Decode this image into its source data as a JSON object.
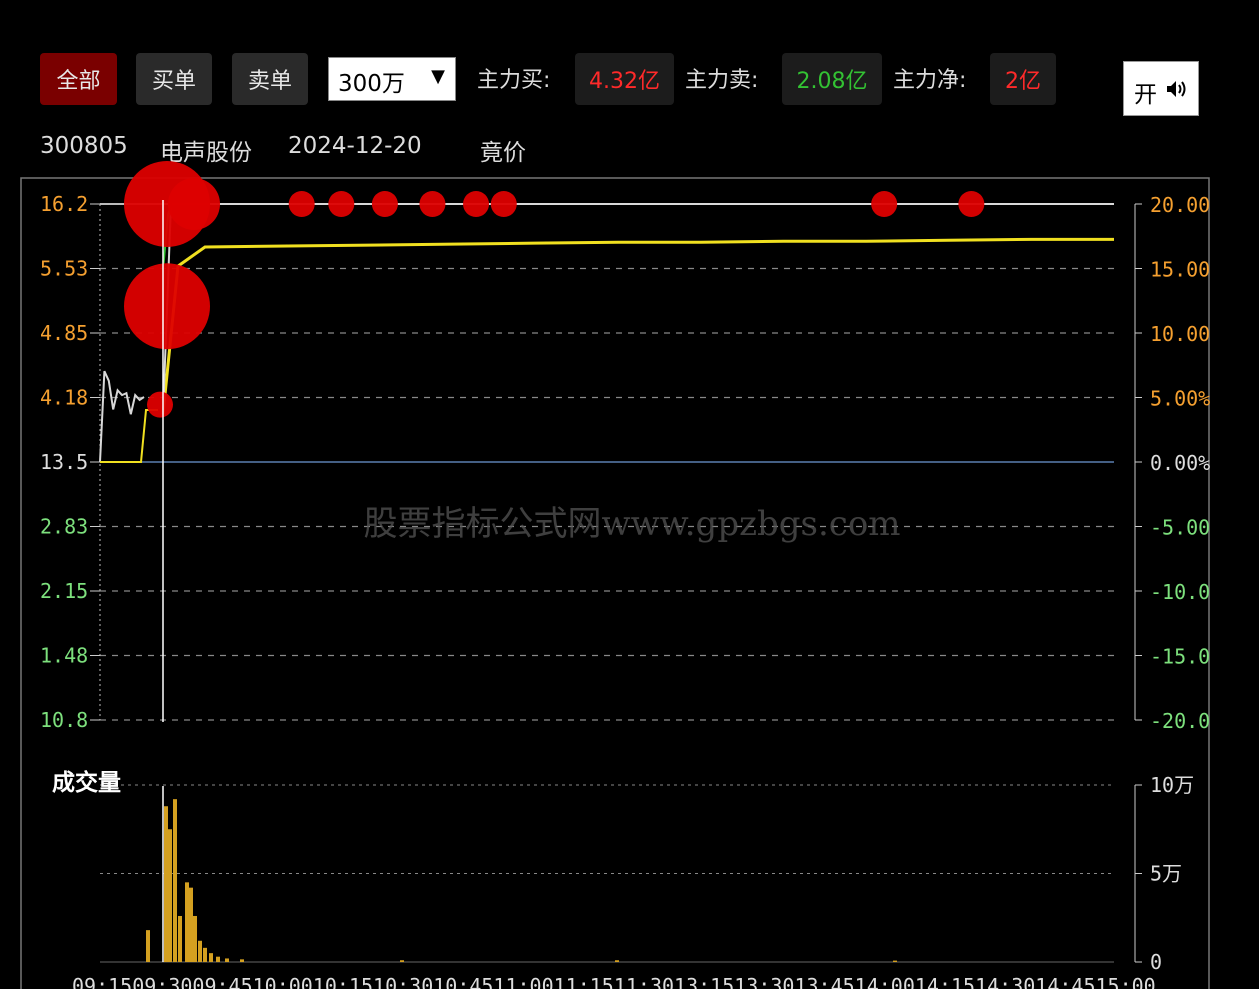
{
  "toolbar": {
    "filters": [
      "全部",
      "买单",
      "卖单"
    ],
    "active_filter": "全部",
    "threshold": "300万",
    "main_buy_label": "主力买:",
    "main_buy_value": "4.32亿",
    "main_sell_label": "主力卖:",
    "main_sell_value": "2.08亿",
    "main_net_label": "主力净:",
    "main_net_value": "2亿",
    "sound_toggle_label": "开"
  },
  "info": {
    "code": "300805",
    "name": "电声股份",
    "date": "2024-12-20",
    "mode": "竟价"
  },
  "watermark": "股票指标公式网www.gpzbgs.com",
  "volume_label": "成交量",
  "colors": {
    "bg": "#000000",
    "up": "#ff2a2a",
    "down": "#33c233",
    "price_line": "#d8d8d8",
    "avg_line": "#f0e020",
    "baseline": "#5b7fb0",
    "volume_bar": "#d4a020",
    "big_order": "#dd0000",
    "axis_up_label": "#f5a030",
    "axis_down_label": "#7de07d"
  },
  "chart_data": {
    "type": "line",
    "price_axis_left": [
      "16.2",
      "5.53",
      "4.85",
      "4.18",
      "13.5",
      "2.83",
      "2.15",
      "1.48",
      "10.8"
    ],
    "pct_axis_right": [
      "20.00",
      "15.00",
      "10.00",
      "5.00%",
      "0.00%",
      "-5.00",
      "-10.0",
      "-15.0",
      "-20.0"
    ],
    "volume_axis": [
      "10万",
      "5万",
      "0"
    ],
    "time_axis": [
      "09:15",
      "09:30",
      "09:45",
      "10:00",
      "10:15",
      "10:30",
      "10:45",
      "11:00",
      "11:15",
      "11:30",
      "13:15",
      "13:30",
      "13:45",
      "14:00",
      "14:15",
      "14:30",
      "14:45",
      "15:00"
    ],
    "time_axis_text": "09:1509:3009:4510:0010:1510:3010:4511:0011:1511:3013:1513:3013:4514:0014:1514:3014:4515:00",
    "auction_price": [
      13.5,
      14.45,
      14.35,
      14.05,
      14.25,
      14.2,
      14.22,
      14.0,
      14.2,
      14.15,
      14.18
    ],
    "price": [
      14.0,
      16.2,
      16.2,
      16.2,
      16.2,
      16.2,
      16.2,
      16.2,
      16.2,
      16.2,
      16.2,
      16.2,
      16.2,
      16.2
    ],
    "avg_price": [
      14.0,
      15.55,
      15.75,
      15.76,
      15.77,
      15.78,
      15.79,
      15.8,
      15.8,
      15.81,
      15.81,
      15.82,
      15.83,
      15.83
    ],
    "big_buy_orders": [
      {
        "time": "09:30",
        "price": 16.2,
        "size": "large"
      },
      {
        "time": "09:30",
        "price": 15.13,
        "size": "large"
      },
      {
        "time": "09:31",
        "price": 16.2,
        "size": "medium"
      },
      {
        "time": "09:29",
        "price": 14.1,
        "size": "small"
      },
      {
        "time": "10:05",
        "price": 16.2,
        "size": "small"
      },
      {
        "time": "10:15",
        "price": 16.2,
        "size": "small"
      },
      {
        "time": "10:26",
        "price": 16.2,
        "size": "small"
      },
      {
        "time": "10:38",
        "price": 16.2,
        "size": "small"
      },
      {
        "time": "10:49",
        "price": 16.2,
        "size": "small"
      },
      {
        "time": "10:56",
        "price": 16.2,
        "size": "small"
      },
      {
        "time": "14:02",
        "price": 16.2,
        "size": "small"
      },
      {
        "time": "14:24",
        "price": 16.2,
        "size": "small"
      }
    ],
    "volume": [
      18000,
      0,
      88000,
      75000,
      92000,
      26000,
      45000,
      42000,
      26000,
      12000,
      8000,
      5000,
      3000,
      2000,
      1500,
      1000,
      1000,
      800
    ],
    "ylim_volume": [
      0,
      100000
    ]
  }
}
